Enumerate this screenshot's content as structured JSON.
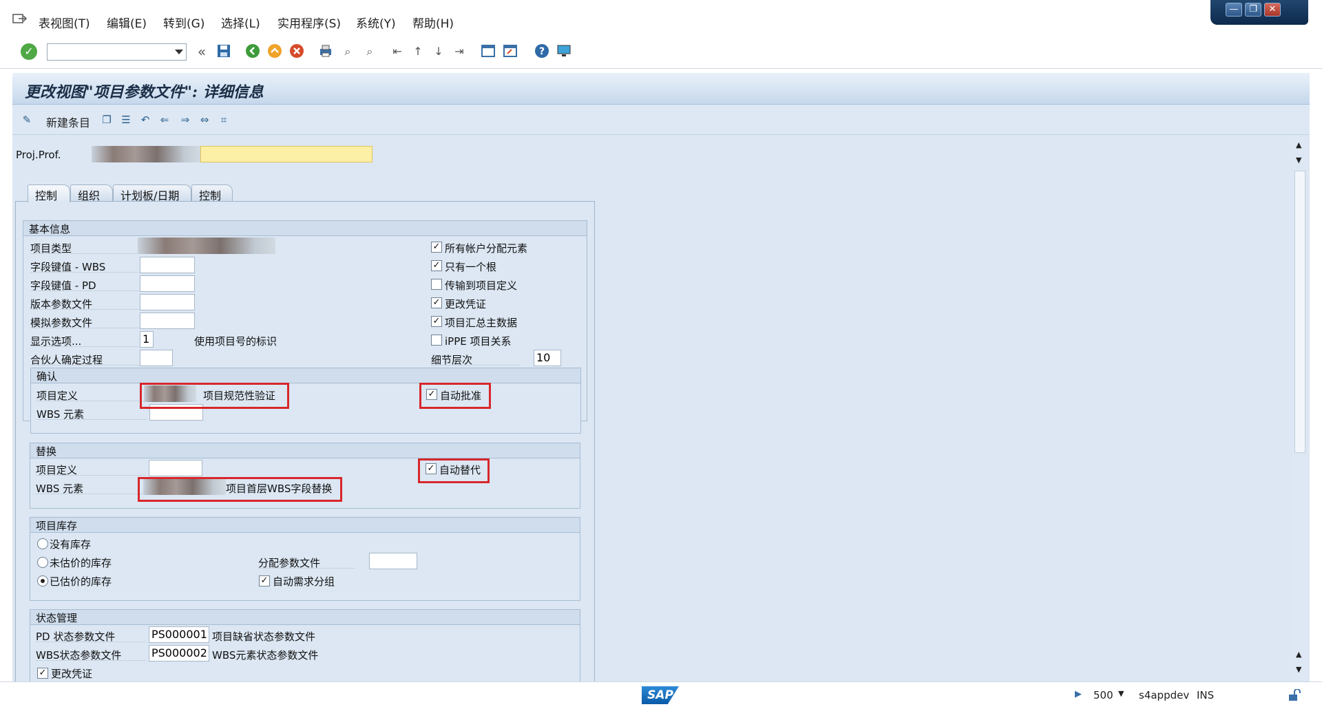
{
  "menu": {
    "items": [
      "表视图(T)",
      "编辑(E)",
      "转到(G)",
      "选择(L)",
      "实用程序(S)",
      "系统(Y)",
      "帮助(H)"
    ]
  },
  "window_controls": {
    "minimize": "—",
    "restore": "❐",
    "close": "✕"
  },
  "toolbar": {
    "command_value": "",
    "back_symbol": "«"
  },
  "title": "更改视图\"项目参数文件\": 详细信息",
  "app_toolbar": {
    "new_entry_label": "新建条目"
  },
  "profile": {
    "label": "Proj.Prof.",
    "value": ""
  },
  "tabs": [
    "控制",
    "组织",
    "计划板/日期",
    "控制"
  ],
  "basic_info": {
    "title": "基本信息",
    "fields": [
      {
        "label": "项目类型",
        "value": ""
      },
      {
        "label": "字段键值 - WBS",
        "value": ""
      },
      {
        "label": "字段键值 - PD",
        "value": ""
      },
      {
        "label": "版本参数文件",
        "value": ""
      },
      {
        "label": "模拟参数文件",
        "value": ""
      },
      {
        "label": "显示选项...",
        "value": "1",
        "desc": "使用项目号的标识"
      },
      {
        "label": "合伙人确定过程",
        "value": ""
      }
    ],
    "checks": [
      {
        "label": "所有帐户分配元素",
        "checked": true
      },
      {
        "label": "只有一个根",
        "checked": true
      },
      {
        "label": "传输到项目定义",
        "checked": false
      },
      {
        "label": "更改凭证",
        "checked": true
      },
      {
        "label": "项目汇总主数据",
        "checked": true
      },
      {
        "label": "iPPE 项目关系",
        "checked": false
      }
    ],
    "detail_level_label": "细节层次",
    "detail_level_value": "10"
  },
  "validation": {
    "title": "确认",
    "proj_def_label": "项目定义",
    "proj_def_desc": "项目规范性验证",
    "wbs_label": "WBS 元素",
    "auto_label": "自动批准",
    "auto_checked": true
  },
  "substitution": {
    "title": "替换",
    "proj_def_label": "项目定义",
    "wbs_label": "WBS 元素",
    "wbs_desc": "项目首层WBS字段替换",
    "auto_label": "自动替代",
    "auto_checked": true
  },
  "stock": {
    "title": "项目库存",
    "options": [
      "没有库存",
      "未估价的库存",
      "已估价的库存"
    ],
    "selected": 2,
    "dist_profile_label": "分配参数文件",
    "auto_req_label": "自动需求分组",
    "auto_req_checked": true
  },
  "status_mgmt": {
    "title": "状态管理",
    "pd_label": "PD 状态参数文件",
    "pd_value": "PS000001",
    "pd_desc": "项目缺省状态参数文件",
    "wbs_label": "WBS状态参数文件",
    "wbs_value": "PS000002",
    "wbs_desc": "WBS元素状态参数文件",
    "change_doc_label": "更改凭证",
    "change_doc_checked": true
  },
  "statusbar": {
    "client": "500",
    "system": "s4appdev",
    "mode": "INS",
    "logo": "SAP"
  },
  "colors": {
    "highlight": "#d8262a",
    "panel": "#dce7f3",
    "required_field": "#fcf0a6"
  }
}
